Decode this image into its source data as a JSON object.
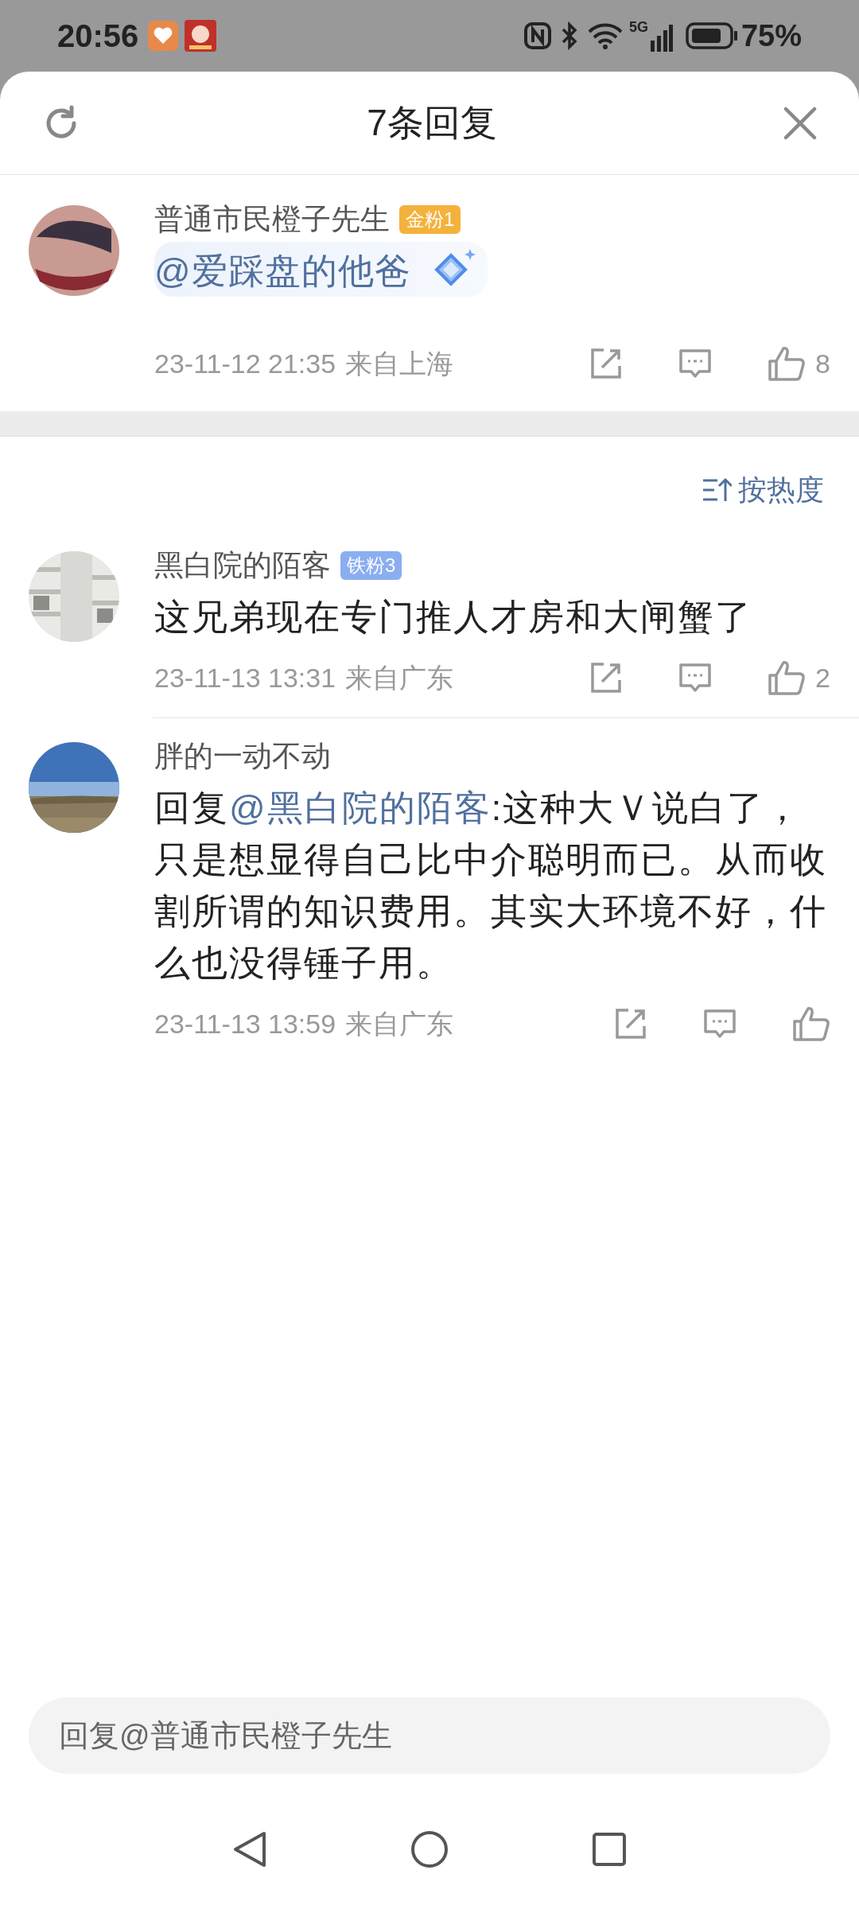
{
  "status_bar": {
    "time": "20:56",
    "network": "5G",
    "battery": "75%"
  },
  "header": {
    "title": "7条回复"
  },
  "main_comment": {
    "author": "普通市民橙子先生",
    "badge": {
      "label": "金粉1",
      "color": "#f4b23c"
    },
    "parts": [
      {
        "kind": "mention",
        "text": "@爱踩盘的他爸"
      }
    ],
    "time": "23-11-12 21:35",
    "location": "来自上海",
    "likes": "8"
  },
  "sort": {
    "label": "按热度"
  },
  "replies": [
    {
      "author": "黑白院的陌客",
      "badge": {
        "label": "铁粉3",
        "color": "#8aaef0"
      },
      "parts": [
        {
          "kind": "plain",
          "text": "这兄弟现在专门推人才房和大闸蟹了"
        }
      ],
      "time": "23-11-13 13:31",
      "location": "来自广东",
      "likes": "2"
    },
    {
      "author": "胖的一动不动",
      "parts": [
        {
          "kind": "plain",
          "text": "回复"
        },
        {
          "kind": "mention",
          "text": "@黑白院的陌客"
        },
        {
          "kind": "plain",
          "text": ":这种大Ｖ说白了，只是想显得自己比中介聪明而已。从而收割所谓的知识费用。其实大环境不好，什么也没得锤子用。"
        }
      ],
      "time": "23-11-13 13:59",
      "location": "来自广东"
    }
  ],
  "reply_field": {
    "placeholder": "回复@普通市民橙子先生"
  }
}
